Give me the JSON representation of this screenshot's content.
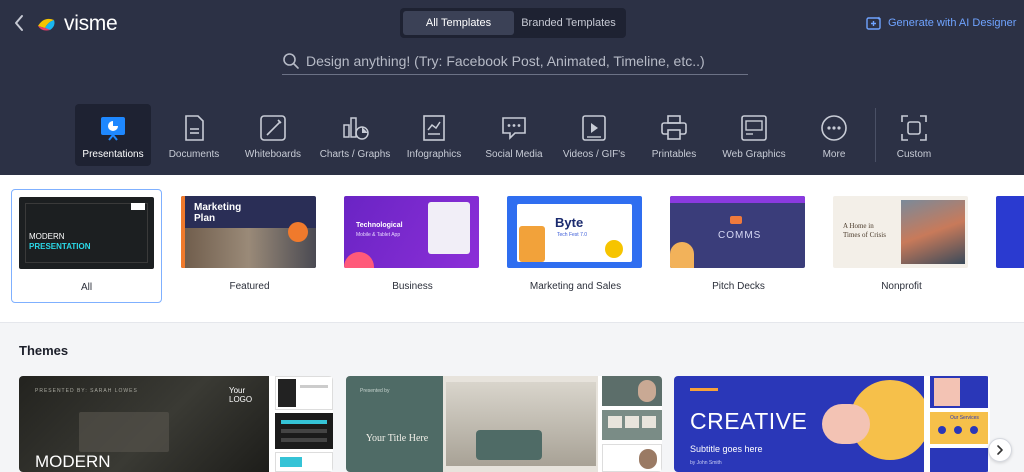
{
  "app": {
    "logo": "visme"
  },
  "header": {
    "tabs": [
      {
        "label": "All Templates",
        "active": true
      },
      {
        "label": "Branded Templates",
        "active": false
      }
    ],
    "ai_button": "Generate with AI Designer",
    "search_placeholder": "Design anything! (Try: Facebook Post, Animated, Timeline, etc..)"
  },
  "categories": [
    {
      "label": "Presentations",
      "icon": "presentation-icon",
      "active": true
    },
    {
      "label": "Documents",
      "icon": "document-icon"
    },
    {
      "label": "Whiteboards",
      "icon": "whiteboard-icon"
    },
    {
      "label": "Charts / Graphs",
      "icon": "chart-icon"
    },
    {
      "label": "Infographics",
      "icon": "infographic-icon"
    },
    {
      "label": "Social Media",
      "icon": "social-media-icon"
    },
    {
      "label": "Videos / GIF's",
      "icon": "video-icon"
    },
    {
      "label": "Printables",
      "icon": "printer-icon"
    },
    {
      "label": "Web Graphics",
      "icon": "web-graphics-icon"
    },
    {
      "label": "More",
      "icon": "more-icon"
    },
    {
      "label": "Custom",
      "icon": "custom-size-icon"
    }
  ],
  "subcategories": [
    {
      "label": "All",
      "thumb_lines": [
        "MODERN",
        "PRESENTATION"
      ]
    },
    {
      "label": "Featured",
      "thumb_lines": [
        "Marketing",
        "Plan"
      ]
    },
    {
      "label": "Business",
      "thumb_lines": [
        "Technological",
        "Mobile & Tablet App"
      ]
    },
    {
      "label": "Marketing and Sales",
      "thumb_lines": [
        "Byte",
        "Tech Fest 7.0"
      ]
    },
    {
      "label": "Pitch Decks",
      "thumb_lines": [
        "COMMS"
      ]
    },
    {
      "label": "Nonprofit",
      "thumb_lines": [
        "A Home in",
        "Times of Crisis"
      ]
    }
  ],
  "themes": {
    "title": "Themes",
    "items": [
      {
        "main_text": "MODERN",
        "sub_text": "PRESENTED BY: SARAH LOWES",
        "logo": "Your LOGO"
      },
      {
        "main_text": "Your Title Here",
        "sub_text": "Presented by",
        "side_text": ""
      },
      {
        "main_text": "CREATIVE",
        "sub_text": "Subtitle goes here",
        "byline": "by John Smith",
        "side_text": "Our Services"
      }
    ]
  },
  "colors": {
    "header_bg": "#2c3145",
    "accent_blue": "#6fa3ff",
    "creative_bg": "#2a37b8"
  }
}
